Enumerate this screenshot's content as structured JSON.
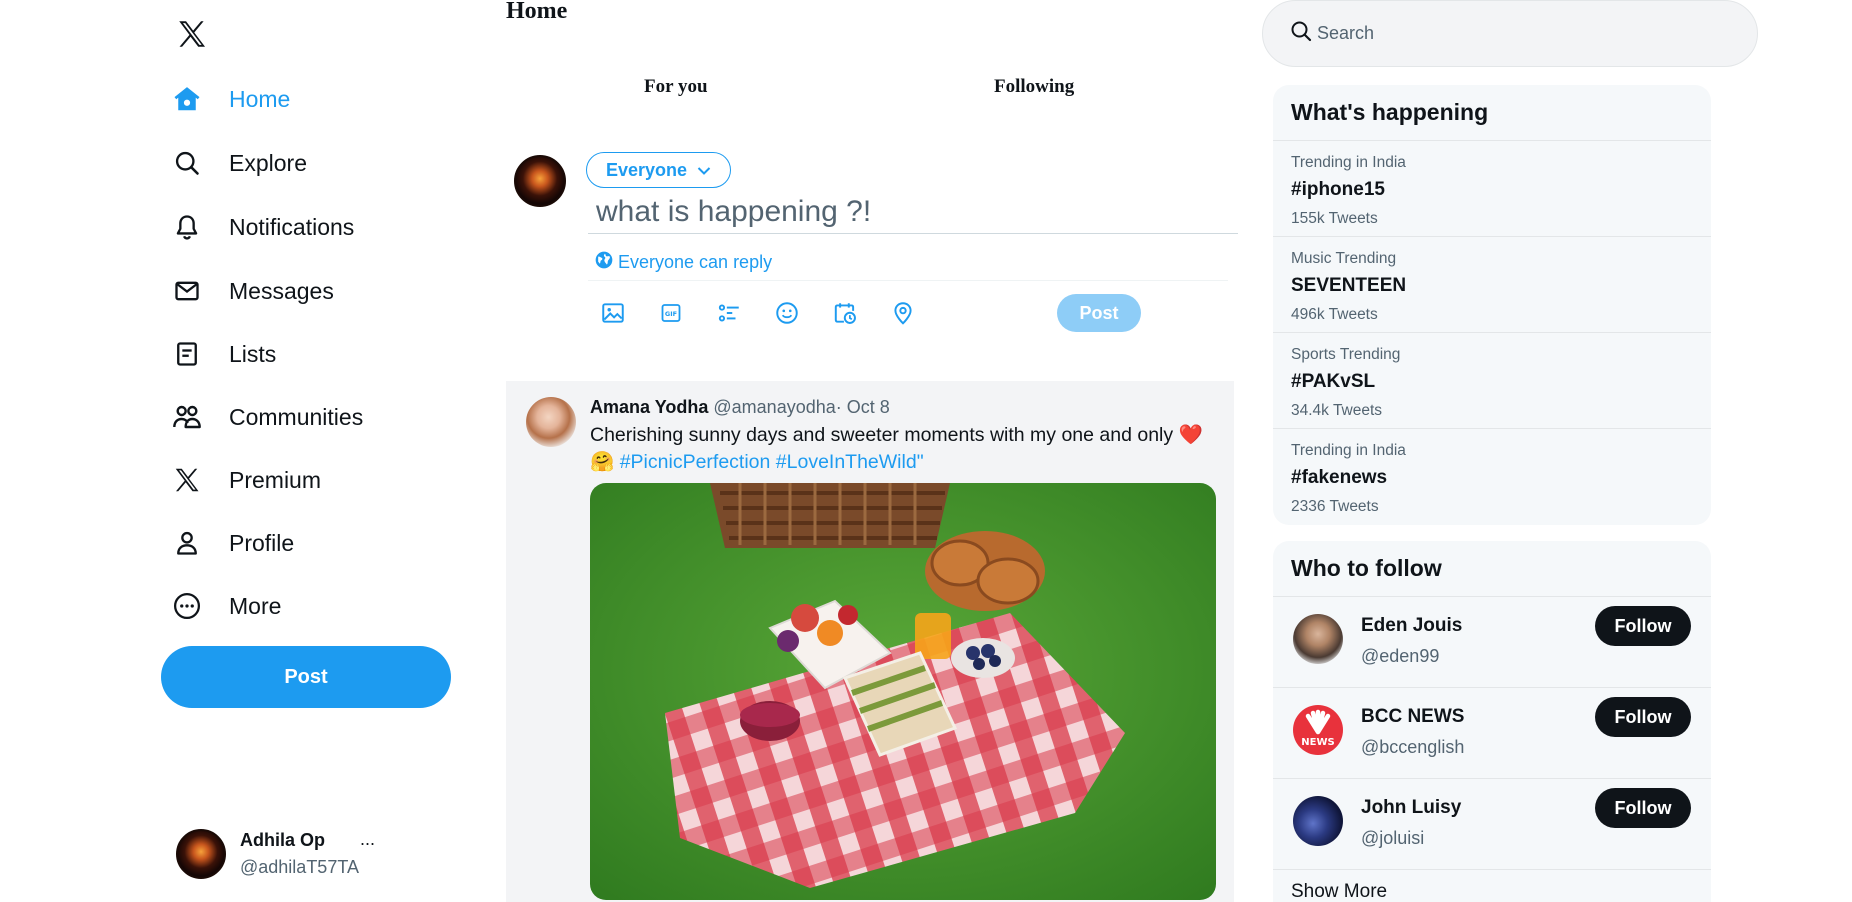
{
  "brand": {
    "logo_icon": "x-logo-icon",
    "accent": "#1d9bf0"
  },
  "nav": [
    {
      "label": "Home",
      "icon": "home-icon",
      "active": true
    },
    {
      "label": "Explore",
      "icon": "search-icon"
    },
    {
      "label": "Notifications",
      "icon": "bell-icon"
    },
    {
      "label": "Messages",
      "icon": "envelope-icon"
    },
    {
      "label": "Lists",
      "icon": "list-icon"
    },
    {
      "label": "Communities",
      "icon": "people-icon"
    },
    {
      "label": "Premium",
      "icon": "x-logo-icon"
    },
    {
      "label": "Profile",
      "icon": "person-icon"
    },
    {
      "label": "More",
      "icon": "more-circle-icon"
    }
  ],
  "sidebar": {
    "post_label": "Post"
  },
  "account": {
    "name": "Adhila Op",
    "handle": "@adhilaT57TA",
    "menu": "..."
  },
  "main": {
    "title": "Home",
    "tabs": [
      {
        "label": "For you"
      },
      {
        "label": "Following"
      }
    ]
  },
  "composer": {
    "audience": "Everyone",
    "placeholder": "what is happening ?!",
    "reply_setting": "Everyone can reply",
    "post_label": "Post",
    "tools": [
      "image-icon",
      "gif-icon",
      "poll-icon",
      "emoji-icon",
      "schedule-icon",
      "location-icon"
    ]
  },
  "tweet": {
    "name": "Amana Yodha",
    "handle": "@amanayodha",
    "date": "· Oct 8",
    "text": "Cherishing sunny days and sweeter moments with my one and only",
    "emoji_heart": "❤️",
    "emoji_hug": "🤗",
    "hashtags": "#PicnicPerfection #LoveInTheWild\"",
    "image_alt": "picnic-photo"
  },
  "search": {
    "placeholder": "Search"
  },
  "trends": {
    "title": "What's happening",
    "items": [
      {
        "context": "Trending in India",
        "tag": "#iphone15",
        "count": "155k Tweets"
      },
      {
        "context": "Music Trending",
        "tag": "SEVENTEEN",
        "count": "496k Tweets"
      },
      {
        "context": "Sports Trending",
        "tag": "#PAKvSL",
        "count": "34.4k Tweets"
      },
      {
        "context": "Trending in India",
        "tag": "#fakenews",
        "count": "2336 Tweets"
      }
    ]
  },
  "who_to_follow": {
    "title": "Who to follow",
    "items": [
      {
        "name": "Eden Jouis",
        "handle": "@eden99",
        "button": "Follow"
      },
      {
        "name": "BCC NEWS",
        "handle": "@bccenglish",
        "button": "Follow",
        "avatar_text": "NEWS"
      },
      {
        "name": "John Luisy",
        "handle": "@joluisi",
        "button": "Follow"
      }
    ],
    "show_more": "Show More"
  }
}
